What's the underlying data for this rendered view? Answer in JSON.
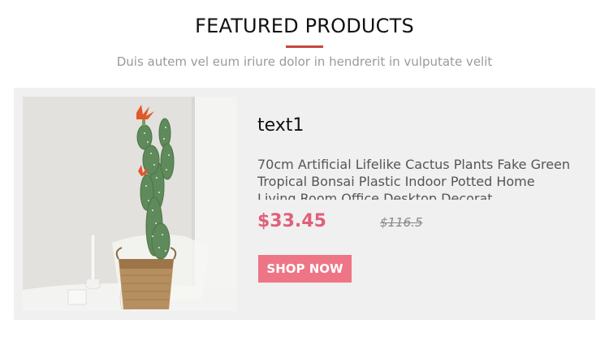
{
  "section": {
    "title": "FEATURED PRODUCTS",
    "subtitle": "Duis autem vel eum iriure dolor in hendrerit in vulputate velit",
    "accent_color": "#c9463d"
  },
  "product": {
    "image_icon": "cactus-plant-photo",
    "name": "text1",
    "description": "70cm Artificial Lifelike Cactus Plants Fake Green Tropical Bonsai Plastic Indoor Potted Home Living Room Office Desktop Decorat",
    "price": "$33.45",
    "old_price": "$116.5",
    "price_color": "#e0607a",
    "button_label": "SHOP NOW",
    "button_color": "#ee7585"
  }
}
